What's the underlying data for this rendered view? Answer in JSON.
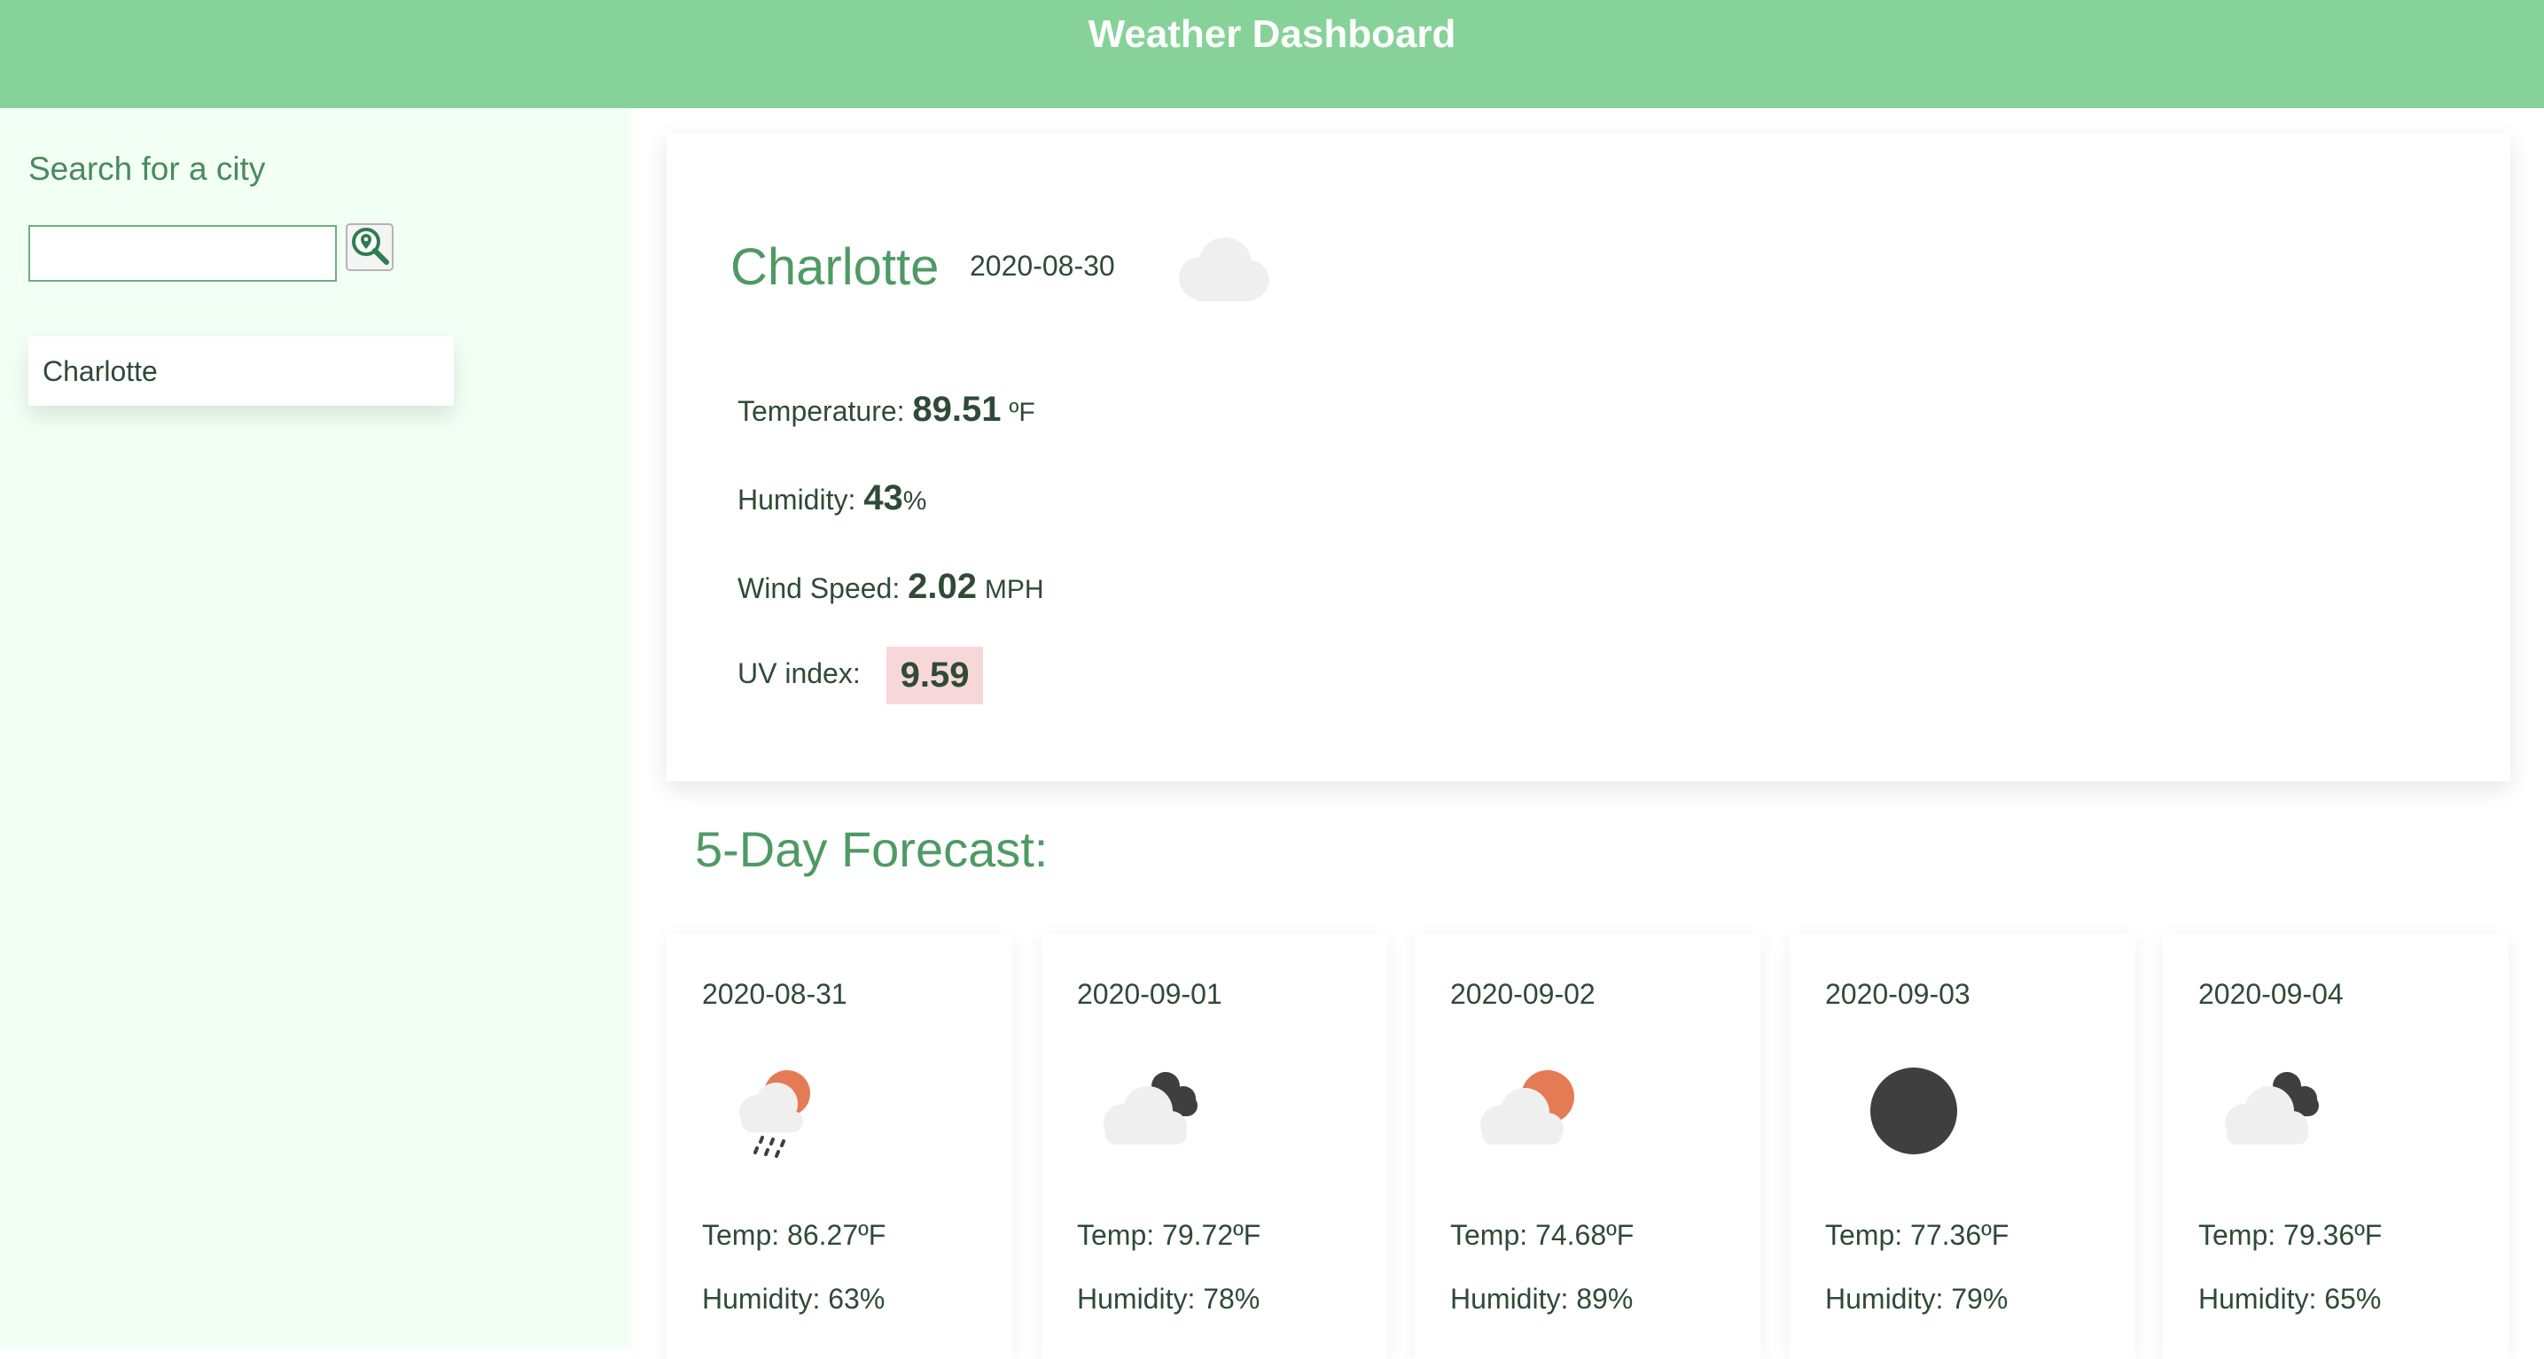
{
  "header": {
    "title": "Weather Dashboard"
  },
  "sidebar": {
    "heading": "Search for a city",
    "search": {
      "value": "",
      "placeholder": "",
      "button_icon": "map-search-icon"
    },
    "history": [
      {
        "label": "Charlotte"
      }
    ]
  },
  "current": {
    "city": "Charlotte",
    "date": "2020-08-30",
    "icon": "cloud-icon",
    "temperature": {
      "label": "Temperature:",
      "value": "89.51",
      "unit": "ºF"
    },
    "humidity": {
      "label": "Humidity:",
      "value": "43",
      "unit": "%"
    },
    "wind": {
      "label": "Wind Speed:",
      "value": "2.02",
      "unit": "MPH"
    },
    "uv": {
      "label": "UV index:",
      "value": "9.59",
      "color": "#f8d7d9"
    }
  },
  "forecast": {
    "heading": "5-Day Forecast:",
    "days": [
      {
        "date": "2020-08-31",
        "icon": "sun-cloud-rain-icon",
        "temp": "Temp: 86.27ºF",
        "humidity": "Humidity: 63%"
      },
      {
        "date": "2020-09-01",
        "icon": "dark-clouds-icon",
        "temp": "Temp: 79.72ºF",
        "humidity": "Humidity: 78%"
      },
      {
        "date": "2020-09-02",
        "icon": "sun-behind-cloud-icon",
        "temp": "Temp: 74.68ºF",
        "humidity": "Humidity: 89%"
      },
      {
        "date": "2020-09-03",
        "icon": "night-clear-icon",
        "temp": "Temp: 77.36ºF",
        "humidity": "Humidity: 79%"
      },
      {
        "date": "2020-09-04",
        "icon": "dark-clouds-icon",
        "temp": "Temp: 79.36ºF",
        "humidity": "Humidity: 65%"
      }
    ]
  },
  "colors": {
    "header": "#86d298",
    "sidebar": "#f1fff4",
    "accent": "#4e9a64",
    "sun": "#e47b55",
    "dark_cloud": "#3f3f3f",
    "light_cloud": "#efefef"
  }
}
